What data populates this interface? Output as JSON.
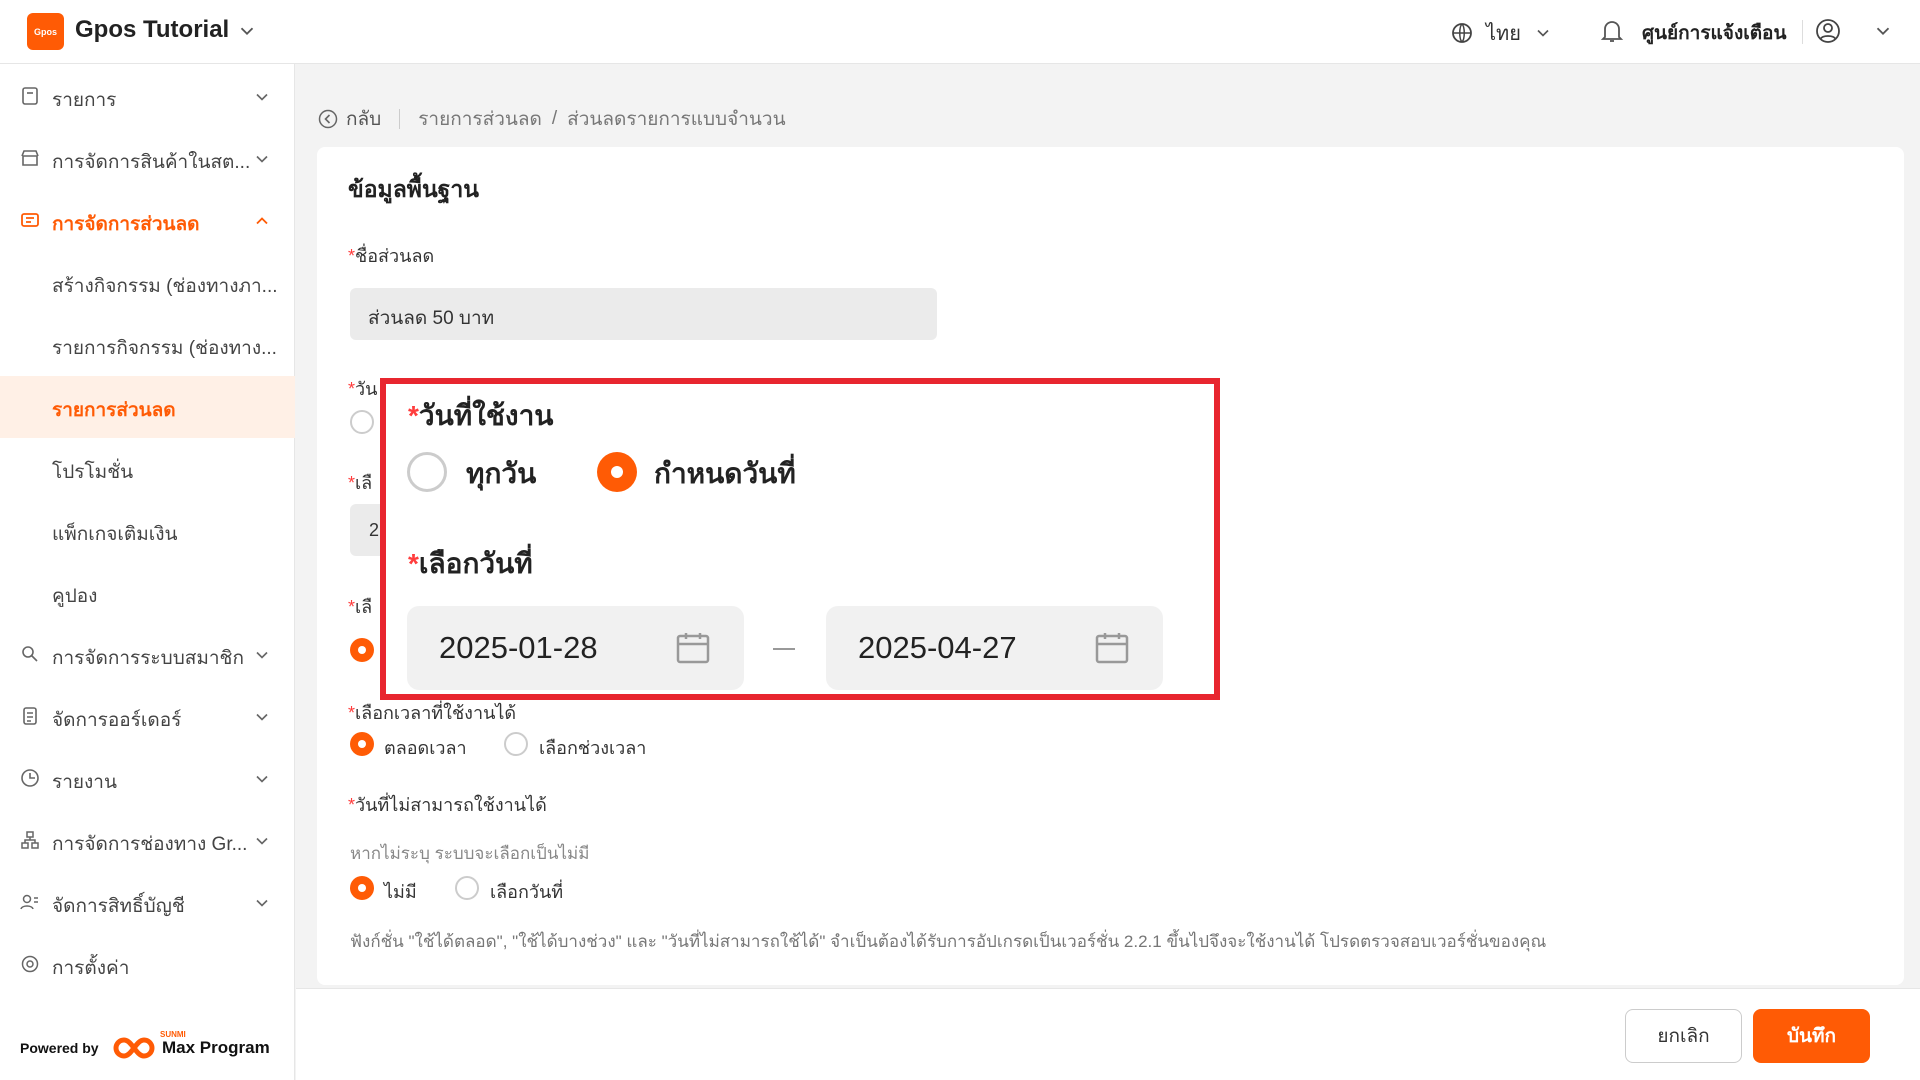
{
  "header": {
    "logo_text": "Gpos",
    "app_title": "Gpos Tutorial",
    "language": "ไทย",
    "notification_center": "ศูนย์การแจ้งเตือน",
    "accent": "#ff5b05"
  },
  "sidebar": {
    "items": [
      {
        "label": "รายการ",
        "icon": "list-icon"
      },
      {
        "label": "การจัดการสินค้าในสต...",
        "icon": "store-icon"
      },
      {
        "label": "การจัดการส่วนลด",
        "icon": "discount-icon"
      },
      {
        "label": "การจัดการระบบสมาชิก",
        "icon": "member-icon"
      },
      {
        "label": "จัดการออร์เดอร์",
        "icon": "order-icon"
      },
      {
        "label": "รายงาน",
        "icon": "report-icon"
      },
      {
        "label": "การจัดการช่องทาง Gr...",
        "icon": "channel-icon"
      },
      {
        "label": "จัดการสิทธิ์บัญชี",
        "icon": "account-icon"
      },
      {
        "label": "การตั้งค่า",
        "icon": "settings-icon"
      }
    ],
    "sub_items": [
      "สร้างกิจกรรม (ช่องทางภา...",
      "รายการกิจกรรม (ช่องทาง...",
      "รายการส่วนลด",
      "โปรโมชั่น",
      "แพ็กเกจเติมเงิน",
      "คูปอง"
    ],
    "powered_by": "Powered by",
    "brand_small": "SUNMI",
    "brand": "Max Program"
  },
  "breadcrumb": {
    "back": "กลับ",
    "parent": "รายการส่วนลด",
    "separator": "/",
    "current": "ส่วนลดรายการแบบจำนวน"
  },
  "form": {
    "section_title": "ข้อมูลพื้นฐาน",
    "required_mark": "*",
    "name_label": "ชื่อส่วนลด",
    "name_value": "ส่วนลด 50 บาท",
    "partial_date_label": "วัน",
    "partial_select_label": "เลื",
    "partial_select_label2": "เลื",
    "partial_value": "2",
    "time_label": "เลือกเวลาที่ใช้งานได้",
    "time_options": [
      "ตลอดเวลา",
      "เลือกช่วงเวลา"
    ],
    "unavailable_label": "วันที่ไม่สามารถใช้งานได้",
    "unavailable_hint": "หากไม่ระบุ ระบบจะเลือกเป็นไม่มี",
    "unavailable_options": [
      "ไม่มี",
      "เลือกวันที่"
    ],
    "note": "ฟังก์ชั่น \"ใช้ได้ตลอด\", \"ใช้ได้บางช่วง\" และ \"วันที่ไม่สามารถใช้ได้\" จำเป็นต้องได้รับการอัปเกรดเป็นเวอร์ชั่น 2.2.1 ขึ้นไปจึงจะใช้งานได้ โปรดตรวจสอบเวอร์ชั่นของคุณ"
  },
  "zoom": {
    "usage_label": "วันที่ใช้งาน",
    "usage_options": [
      "ทุกวัน",
      "กำหนดวันที่"
    ],
    "select_date_label": "เลือกวันที่",
    "start_date": "2025-01-28",
    "end_date": "2025-04-27",
    "highlight_color": "#e8262f"
  },
  "footer": {
    "cancel": "ยกเลิก",
    "save": "บันทึก"
  }
}
